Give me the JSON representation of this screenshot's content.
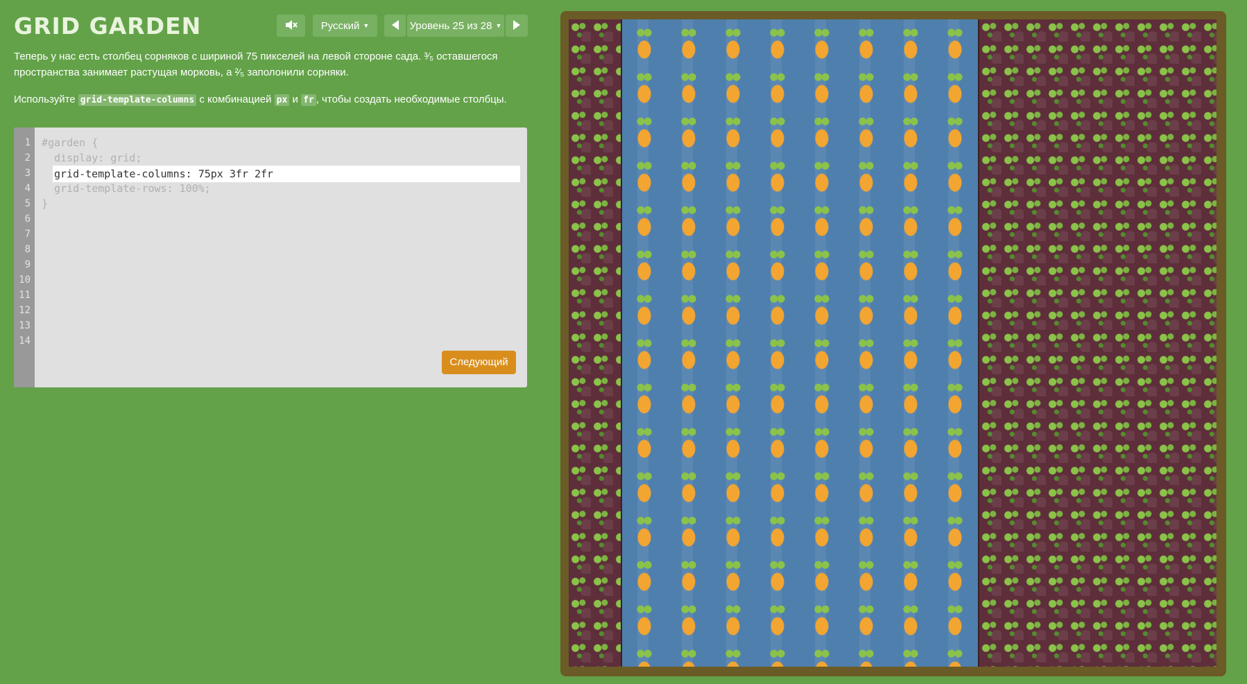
{
  "app": {
    "title": "GRID GARDEN"
  },
  "header": {
    "sound_icon": "muted-speaker-icon",
    "language_label": "Русский",
    "level_label": "Уровень 25 из 28",
    "prev_icon": "triangle-left-icon",
    "next_icon": "triangle-right-icon"
  },
  "instructions": {
    "p1": "Теперь у нас есть столбец сорняков с шириной 75 пикселей на левой стороне сада. ³⁄₅ оставшегося пространства занимает растущая морковь, а ²⁄₅ заполонили сорняки.",
    "p2_before": "Используйте ",
    "p2_code1": "grid-template-columns",
    "p2_mid1": " с комбинацией ",
    "p2_code2": "px",
    "p2_mid2": " и ",
    "p2_code3": "fr",
    "p2_after": ", чтобы создать необходимые столбцы."
  },
  "editor": {
    "line_numbers": [
      "1",
      "2",
      "3",
      "4",
      "5",
      "6",
      "7",
      "8",
      "9",
      "10",
      "11",
      "12",
      "13",
      "14"
    ],
    "line1": "#garden {",
    "line2": "  display: grid;",
    "input_value": "grid-template-columns: 75px 3fr 2fr",
    "line4": "  grid-template-rows: 100%;",
    "line5": "}",
    "next_button_label": "Следующий"
  },
  "colors": {
    "background": "#63a249",
    "button": "#79b163",
    "next_button": "#d98e1c",
    "soil_weeds": "#5e2e3a",
    "soil_carrots": "#4f7fad",
    "frame": "#6b5b26"
  },
  "garden": {
    "columns": [
      "weeds",
      "carrots",
      "weeds"
    ]
  }
}
